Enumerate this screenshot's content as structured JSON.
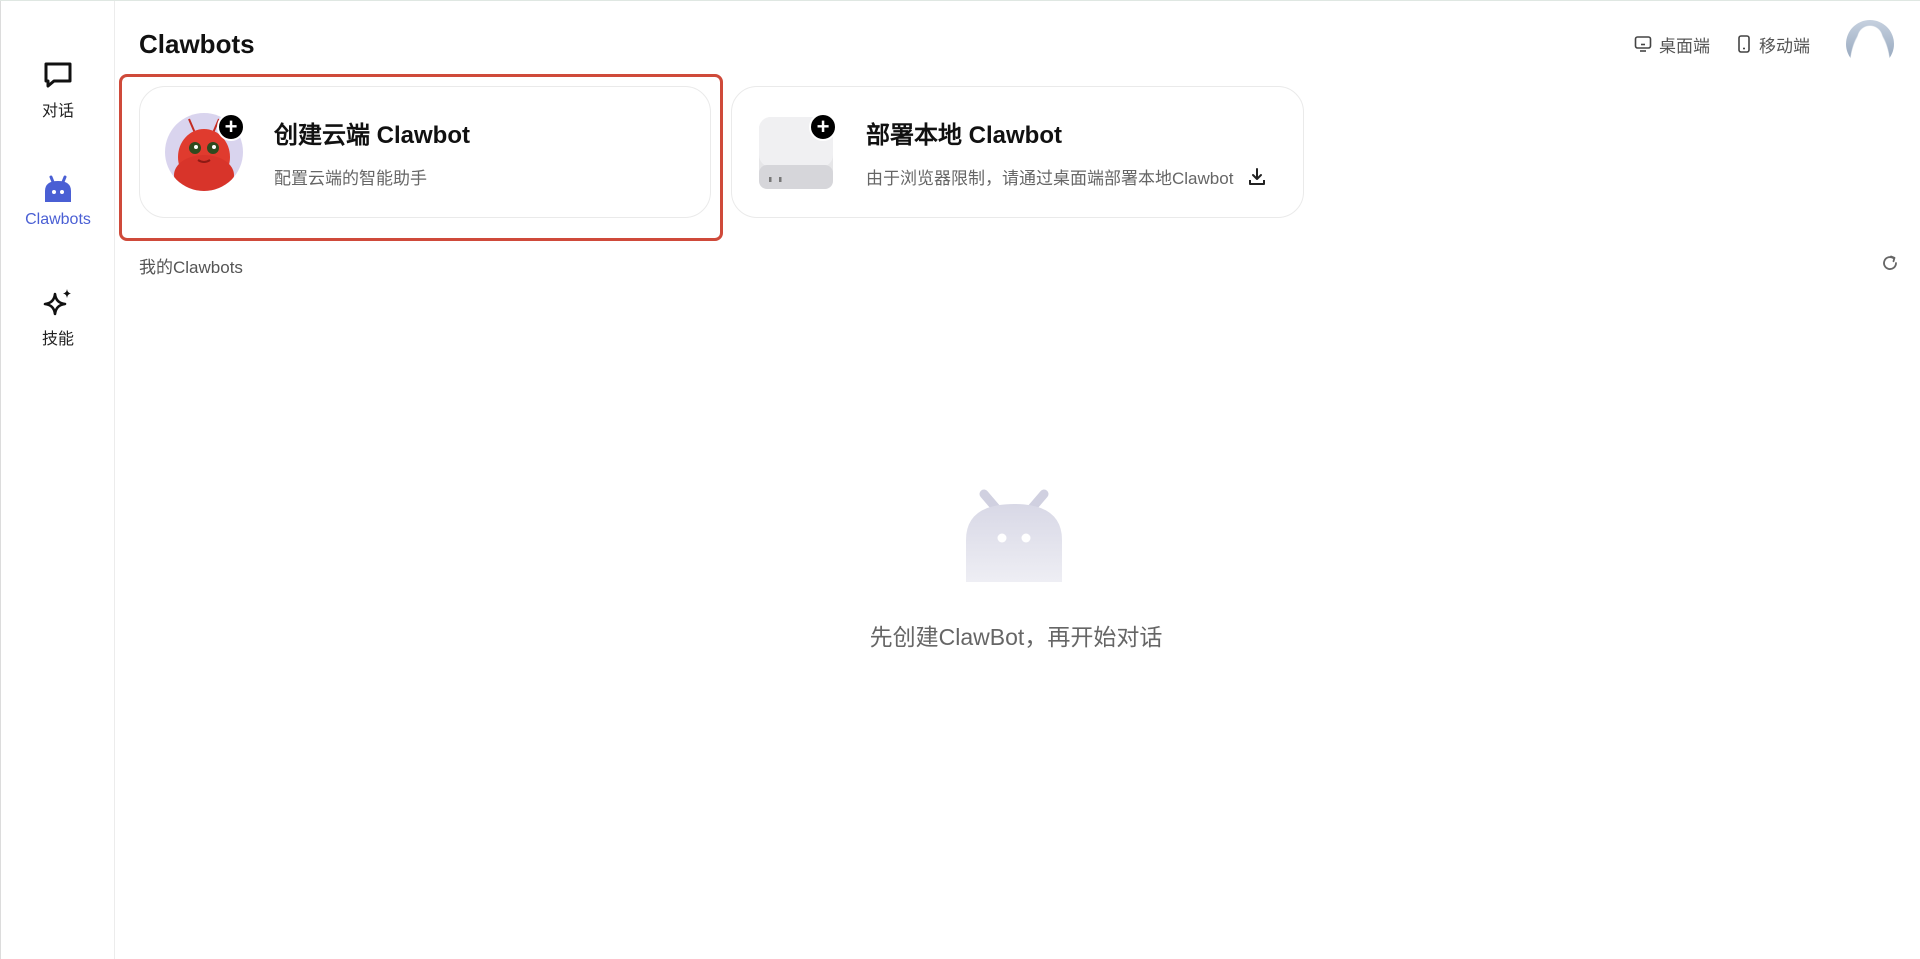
{
  "sidebar": {
    "items": [
      {
        "label": "对话",
        "icon": "chat-bubble-icon",
        "active": false
      },
      {
        "label": "Clawbots",
        "icon": "robot-icon",
        "active": true
      },
      {
        "label": "技能",
        "icon": "sparkle-icon",
        "active": false
      }
    ]
  },
  "header": {
    "title": "Clawbots",
    "links": [
      {
        "label": "桌面端",
        "icon": "desktop-icon"
      },
      {
        "label": "移动端",
        "icon": "mobile-icon"
      }
    ],
    "avatar_icon": "user-avatar"
  },
  "cards": {
    "cloud": {
      "title": "创建云端 Clawbot",
      "description": "配置云端的智能助手",
      "badge": "+",
      "image": "red-lobster-mascot"
    },
    "local": {
      "title": "部署本地 Clawbot",
      "description": "由于浏览器限制，请通过桌面端部署本地Clawbot",
      "badge": "+",
      "image": "mini-pc-device",
      "action_icon": "download-icon"
    }
  },
  "section": {
    "label": "我的Clawbots",
    "action_icon": "refresh-icon"
  },
  "empty_state": {
    "icon": "robot-placeholder-icon",
    "message": "先创建ClawBot，再开始对话"
  },
  "colors": {
    "accent": "#4a5fd4",
    "highlight": "#cf4a3a",
    "empty_icon": "#d8d8e6"
  }
}
